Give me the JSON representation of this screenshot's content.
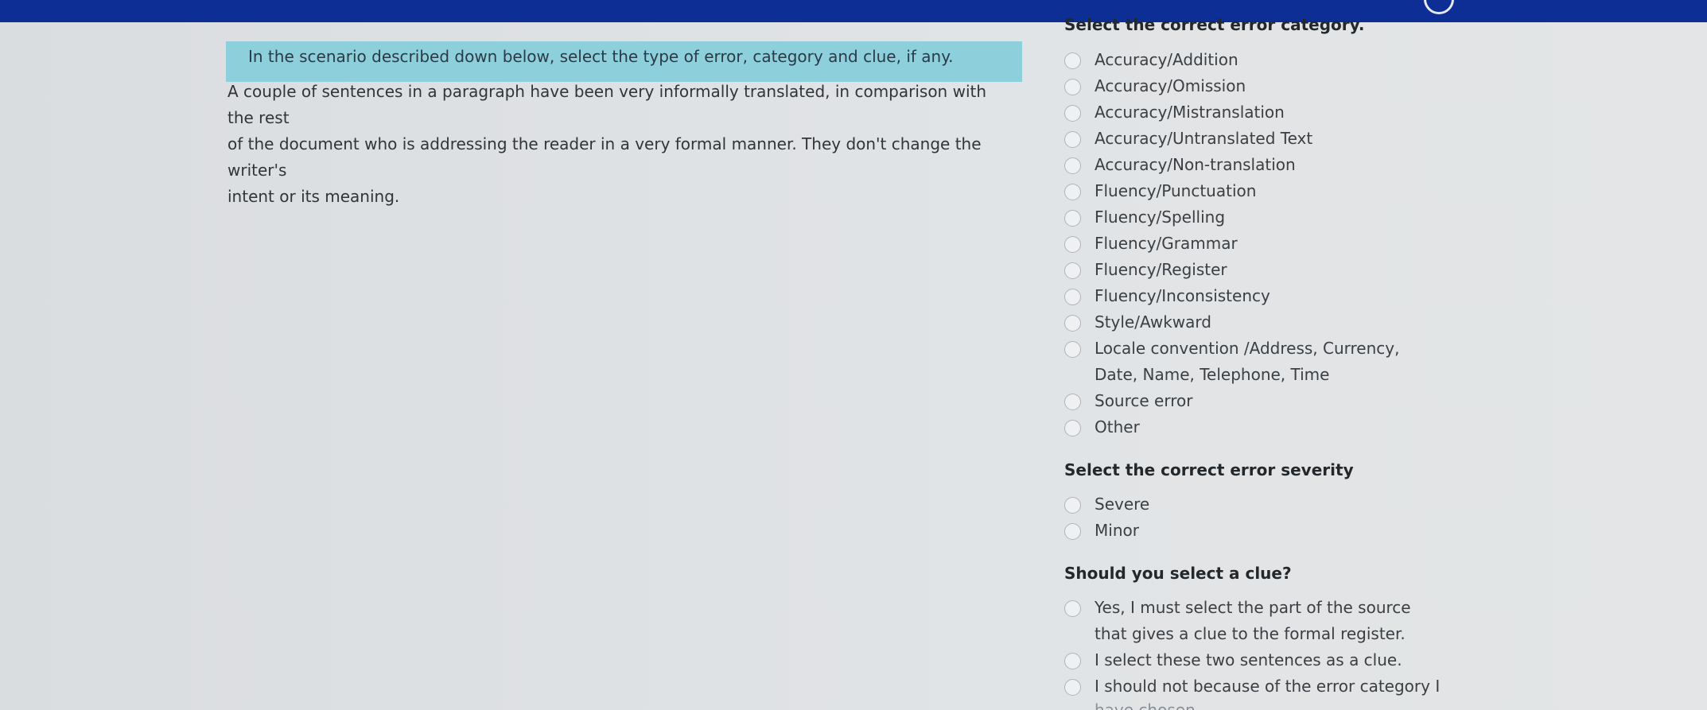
{
  "question": {
    "prompt": "In the scenario described down below, select the type of error, category and clue, if any.",
    "scenario_lines": [
      "A couple of sentences in a paragraph have been very informally translated, in comparison with the rest",
      "of the document who is addressing the reader in a very formal manner. They don't change the writer's",
      "intent or its meaning."
    ]
  },
  "category": {
    "heading": "Select the correct error category.",
    "options": [
      "Accuracy/Addition",
      "Accuracy/Omission",
      "Accuracy/Mistranslation",
      "Accuracy/Untranslated Text",
      "Accuracy/Non-translation",
      "Fluency/Punctuation",
      "Fluency/Spelling",
      "Fluency/Grammar",
      "Fluency/Register",
      "Fluency/Inconsistency",
      "Style/Awkward",
      "Locale convention /Address, Currency,",
      "Source error",
      "Other"
    ],
    "locale_continuation": "Date, Name, Telephone, Time"
  },
  "severity": {
    "heading": "Select the correct error severity",
    "options": [
      "Severe",
      "Minor"
    ]
  },
  "clue": {
    "heading": "Should you select a clue?",
    "option1_line1": "Yes, I must select the part of the source",
    "option1_line2": "that gives a clue to the formal register.",
    "option2": "I select these two sentences as a clue.",
    "option3_line1": "I should not because of the error category I",
    "option3_line2": "have chosen"
  }
}
